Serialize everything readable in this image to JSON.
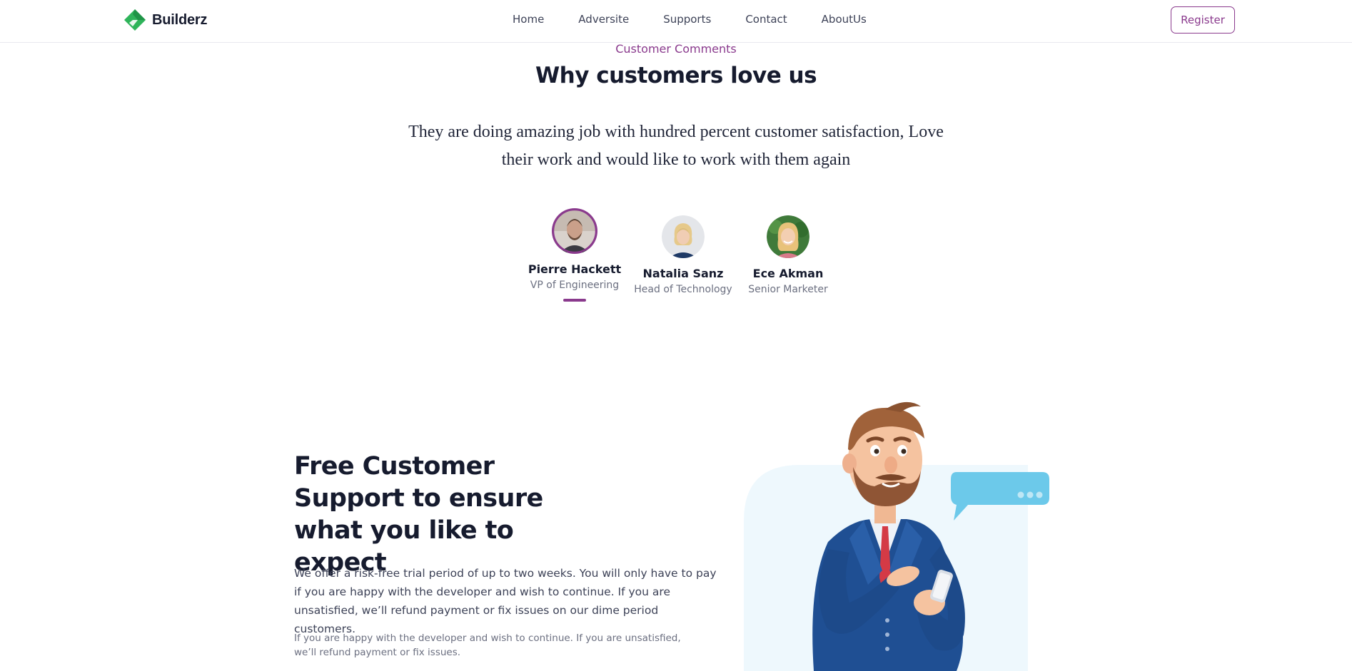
{
  "nav": {
    "brand": "Builderz",
    "links": [
      "Home",
      "Adversite",
      "Supports",
      "Contact",
      "AboutUs"
    ],
    "register_label": "Register"
  },
  "testimonials": {
    "eyebrow": "Customer Comments",
    "title": "Why customers love us",
    "quote": "They are doing amazing job with hundred percent customer satisfaction, Love their work and would like to work with them again",
    "people": [
      {
        "name": "Pierre Hackett",
        "role": "VP of Engineering",
        "active": true
      },
      {
        "name": "Natalia Sanz",
        "role": "Head of Technology",
        "active": false
      },
      {
        "name": "Ece Akman",
        "role": "Senior Marketer",
        "active": false
      }
    ]
  },
  "support": {
    "title": "Free Customer Support to ensure what you like to expect",
    "body": "We offer a risk-free trial period of up to two weeks. You will only have to pay if you are happy with the developer and wish to continue. If you are unsatisfied, we’ll refund payment or fix issues on our dime period customers.",
    "note": "If you are happy with the developer and wish to continue. If you are unsatisfied, we’ll refund payment or fix issues."
  },
  "colors": {
    "accent": "#8a3a8d",
    "brand_green": "#2fb45a",
    "heading": "#161b2e",
    "illustration_bg": "#eef8fd",
    "bubble": "#6cc9ea"
  },
  "icons": [
    "builderz-logo-icon",
    "support-man-illustration",
    "chat-bubble-icon"
  ]
}
